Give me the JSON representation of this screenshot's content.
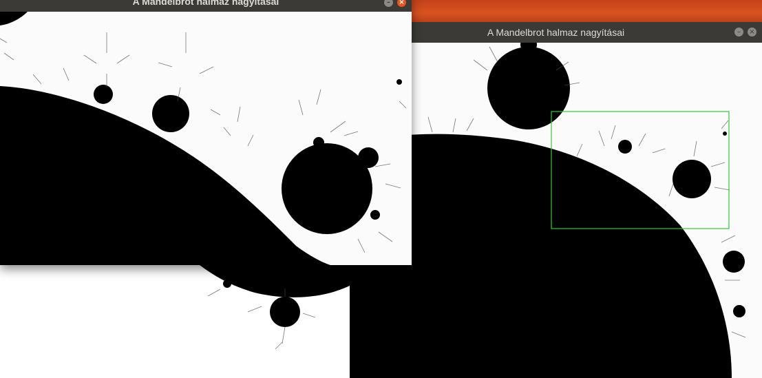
{
  "back_window": {
    "title": "A Mandelbrot halmaz nagyításai",
    "buttons": {
      "minimize": "minimize-icon",
      "close": "close-icon"
    },
    "selection_color": "#33cc33"
  },
  "front_window": {
    "title": "A Mandelbrot halmaz nagyításai",
    "buttons": {
      "minimize": "minimize-icon",
      "close": "close-icon"
    }
  },
  "colors": {
    "titlebar": "#3b3a36",
    "title_text": "#dcdcd6",
    "close_button": "#e95420",
    "minimize_button": "#8a8a86",
    "desktop": "#d9531f"
  }
}
